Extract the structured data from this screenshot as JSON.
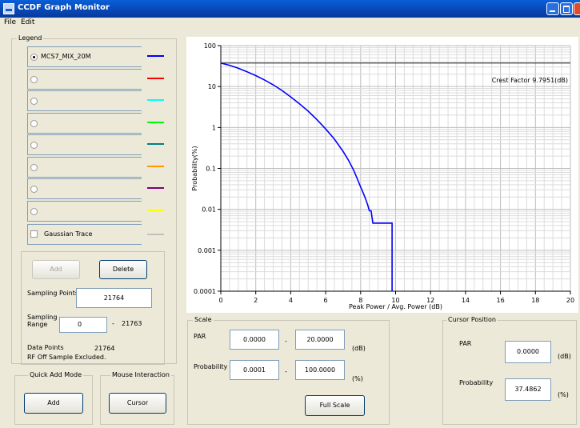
{
  "window": {
    "title": "CCDF Graph Monitor"
  },
  "menu": {
    "file": "File",
    "edit": "Edit"
  },
  "icons": {
    "app": "app-icon",
    "minimize": "minimize-icon",
    "maximize": "maximize-icon",
    "close": "close-icon"
  },
  "legend": {
    "title": "Legend",
    "rows": [
      {
        "label": "MCS7_MIX_20M",
        "selected": true,
        "color": "#0000ff"
      },
      {
        "label": "",
        "selected": false,
        "color": "#ff0000"
      },
      {
        "label": "",
        "selected": false,
        "color": "#00ffff"
      },
      {
        "label": "",
        "selected": false,
        "color": "#00ff00"
      },
      {
        "label": "",
        "selected": false,
        "color": "#008080"
      },
      {
        "label": "",
        "selected": false,
        "color": "#ff9900"
      },
      {
        "label": "",
        "selected": false,
        "color": "#800080"
      },
      {
        "label": "",
        "selected": false,
        "color": "#ffff00"
      }
    ],
    "gaussian": {
      "label": "Gaussian Trace",
      "checked": false,
      "color": "#c0c0c0"
    }
  },
  "controls": {
    "add_label": "Add",
    "delete_label": "Delete",
    "sampling_points_label": "Sampling Points",
    "sampling_points_value": "21764",
    "sampling_range_label": "Sampling Range",
    "sampling_range_from": "0",
    "sampling_range_dash": "-",
    "sampling_range_to": "21763",
    "data_points_label": "Data Points",
    "data_points_value": "21764",
    "rf_off_note": "RF Off Sample Excluded."
  },
  "quick_add": {
    "title": "Quick Add Mode",
    "button": "Add"
  },
  "mouse_interaction": {
    "title": "Mouse Interaction",
    "button": "Cursor"
  },
  "scale": {
    "title": "Scale",
    "par_label": "PAR",
    "par_min": "0.0000",
    "par_max": "20.0000",
    "par_unit": "(dB)",
    "prob_label": "Probability",
    "prob_min": "0.0001",
    "prob_max": "100.0000",
    "prob_unit": "(%)",
    "dash": "-",
    "full_scale": "Full Scale"
  },
  "cursor": {
    "title": "Cursor Position",
    "par_label": "PAR",
    "par_value": "0.0000",
    "par_unit": "(dB)",
    "prob_label": "Probability",
    "prob_value": "37.4862",
    "prob_unit": "(%)"
  },
  "chart_data": {
    "type": "line",
    "xlabel": "Peak Power / Avg. Power (dB)",
    "ylabel": "Probability(%)",
    "xlim": [
      0,
      20
    ],
    "ylim": [
      0.0001,
      100
    ],
    "yscale": "log",
    "grid": true,
    "x_ticks": [
      "0",
      "2",
      "4",
      "6",
      "8",
      "10",
      "12",
      "14",
      "16",
      "18",
      "20"
    ],
    "y_ticks": [
      "100",
      "10",
      "1",
      "0.1",
      "0.01",
      "0.001",
      "0.0001"
    ],
    "annotation": "Crest Factor 9.7951(dB)",
    "reference_line_y": 37.4862,
    "series": [
      {
        "name": "MCS7_MIX_20M",
        "color": "#0000ff",
        "x": [
          0,
          0.5,
          1,
          1.5,
          2,
          2.5,
          3,
          3.5,
          4,
          4.5,
          5,
          5.5,
          6,
          6.5,
          7,
          7.3,
          7.6,
          7.8,
          8.0,
          8.1,
          8.2,
          8.3,
          8.4,
          8.5,
          8.6,
          8.65,
          8.7,
          8.75,
          8.85,
          8.95,
          9.0,
          9.0,
          9.8,
          9.8
        ],
        "y": [
          37.5,
          33,
          28,
          23,
          18.5,
          14.5,
          11,
          8,
          5.6,
          3.8,
          2.5,
          1.55,
          0.92,
          0.52,
          0.26,
          0.16,
          0.09,
          0.057,
          0.035,
          0.028,
          0.022,
          0.017,
          0.013,
          0.0092,
          0.0092,
          0.0064,
          0.0046,
          0.0046,
          0.0046,
          0.0046,
          0.0046,
          0.0046,
          0.0046,
          0.0001
        ]
      }
    ]
  }
}
